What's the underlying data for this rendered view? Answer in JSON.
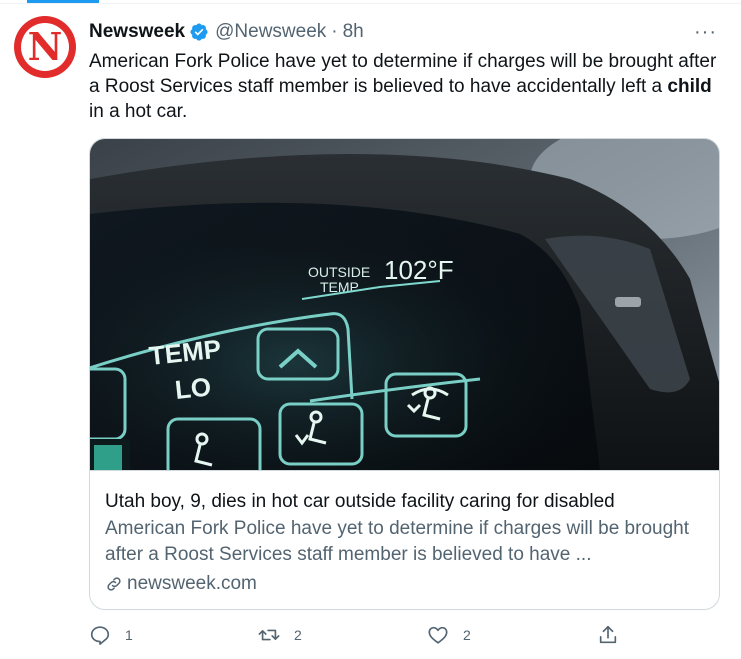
{
  "tweet": {
    "author_name": "Newsweek",
    "author_handle": "@Newsweek",
    "separator": "·",
    "timestamp": "8h",
    "avatar_letter": "N",
    "text_before": "American Fork Police have yet to determine if charges will be brought after a Roost Services staff member is believed to have accidentally left a ",
    "text_bold": "child",
    "text_after": " in a hot car.",
    "more_label": "···"
  },
  "card": {
    "image": {
      "display_outside_label_1": "OUTSIDE",
      "display_outside_label_2": "TEMP",
      "display_temp": "102°F",
      "button_temp_1": "TEMP",
      "button_temp_2": "LO"
    },
    "title": "Utah boy, 9, dies in hot car outside facility caring for disabled",
    "description": "American Fork Police have yet to determine if charges will be brought after a Roost Services staff member is believed to have ...",
    "domain": "newsweek.com"
  },
  "actions": {
    "replies": "1",
    "retweets": "2",
    "likes": "2"
  },
  "colors": {
    "accent": "#1d9bf0",
    "brand_red": "#e22c2c",
    "secondary_text": "#536471",
    "border": "#cfd9de"
  }
}
